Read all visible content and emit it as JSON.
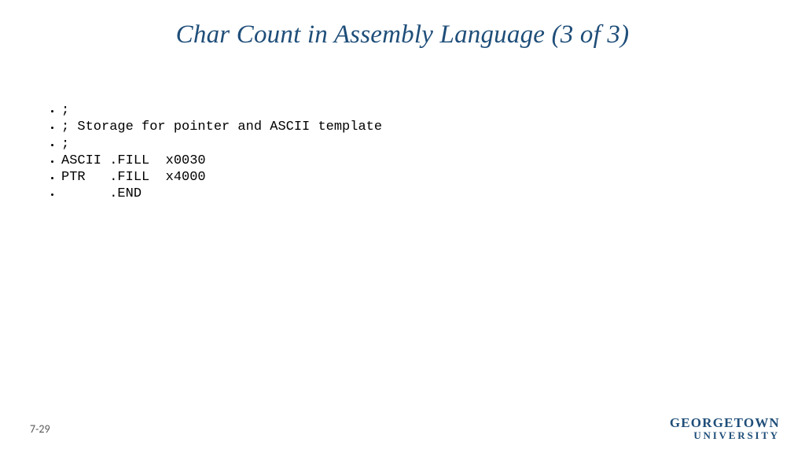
{
  "title": "Char Count in Assembly Language (3 of 3)",
  "bullets": [
    ";",
    "; Storage for pointer and ASCII template",
    ";",
    "ASCII .FILL  x0030",
    "PTR   .FILL  x4000",
    "      .END"
  ],
  "pageNumber": "7-29",
  "logoLine1": "GEORGETOWN",
  "logoLine2": "UNIVERSITY"
}
